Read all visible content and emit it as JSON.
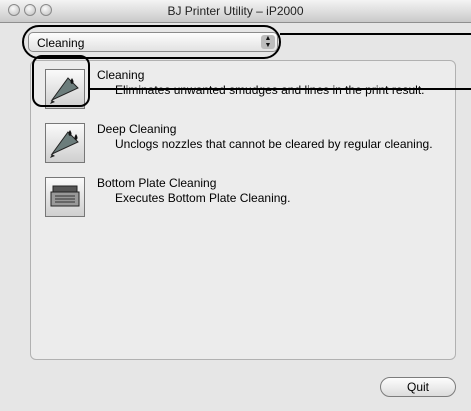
{
  "window": {
    "title": "BJ Printer Utility – iP2000"
  },
  "dropdown": {
    "selected": "Cleaning"
  },
  "items": [
    {
      "title": "Cleaning",
      "description": "Eliminates unwanted smudges and lines in the print result."
    },
    {
      "title": "Deep Cleaning",
      "description": "Unclogs nozzles that cannot be cleared by regular cleaning."
    },
    {
      "title": "Bottom Plate Cleaning",
      "description": "Executes Bottom Plate Cleaning."
    }
  ],
  "quit_label": "Quit",
  "icons": [
    "cleaning-icon",
    "deep-cleaning-icon",
    "bottom-plate-cleaning-icon"
  ]
}
